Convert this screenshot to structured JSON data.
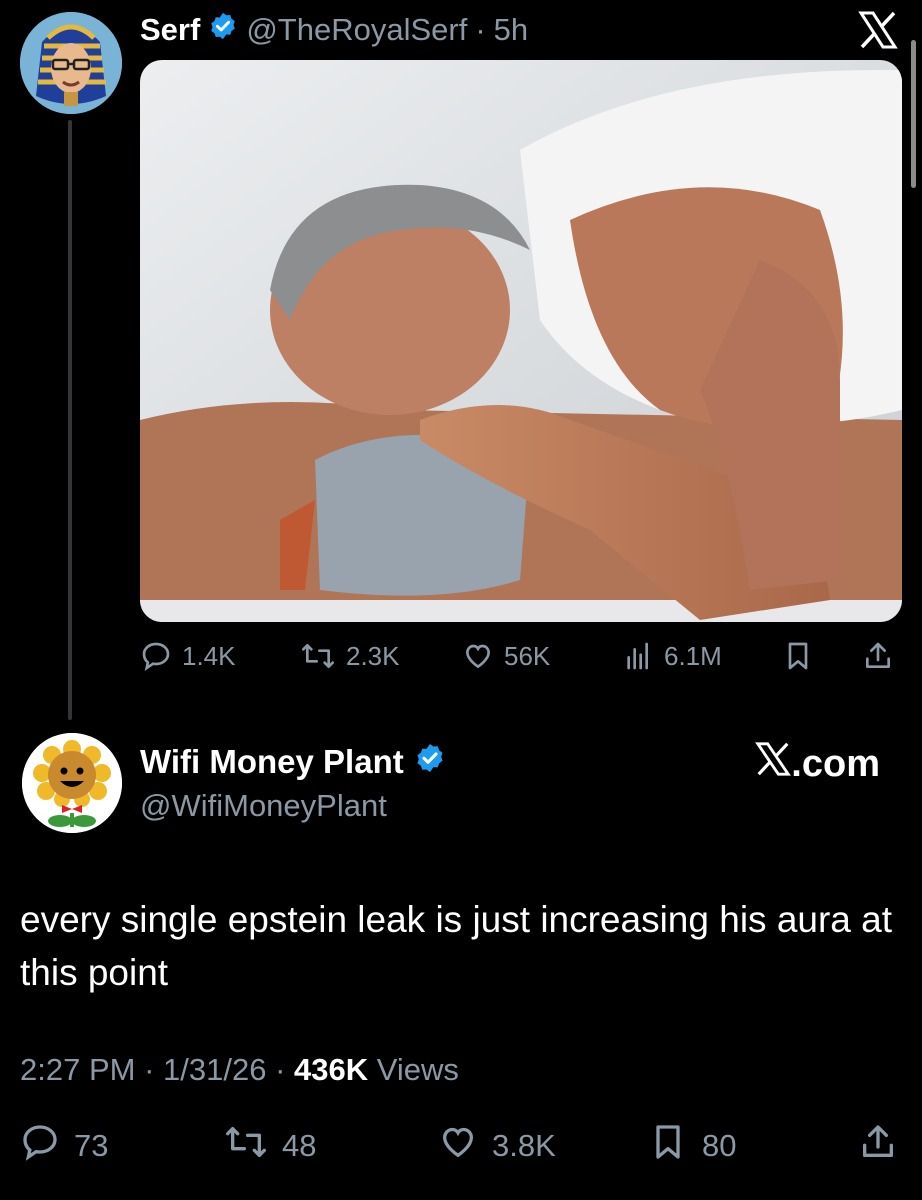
{
  "quoted_tweet": {
    "name": "Serf",
    "handle": "@TheRoyalSerf",
    "separator": "·",
    "age": "5h",
    "stats": {
      "replies": "1.4K",
      "retweets": "2.3K",
      "likes": "56K",
      "views": "6.1M"
    }
  },
  "main_tweet": {
    "name": "Wifi Money Plant",
    "handle": "@WifiMoneyPlant",
    "watermark": ".com",
    "text": "every single epstein leak is just increasing his aura at this point",
    "time": "2:27 PM",
    "date": "1/31/26",
    "meta_sep": "·",
    "views_count": "436K",
    "views_label": "Views",
    "stats": {
      "replies": "73",
      "retweets": "48",
      "likes": "3.8K",
      "bookmarks": "80"
    }
  },
  "icons": [
    "x-logo-icon",
    "verified-badge-icon",
    "reply-icon",
    "retweet-icon",
    "like-icon",
    "views-icon",
    "bookmark-icon",
    "share-icon"
  ],
  "colors": {
    "background": "#000000",
    "text": "#e7e9ea",
    "secondary_text": "#8b98a5",
    "verified_blue": "#1d9bf0",
    "thread_line": "#333639"
  }
}
